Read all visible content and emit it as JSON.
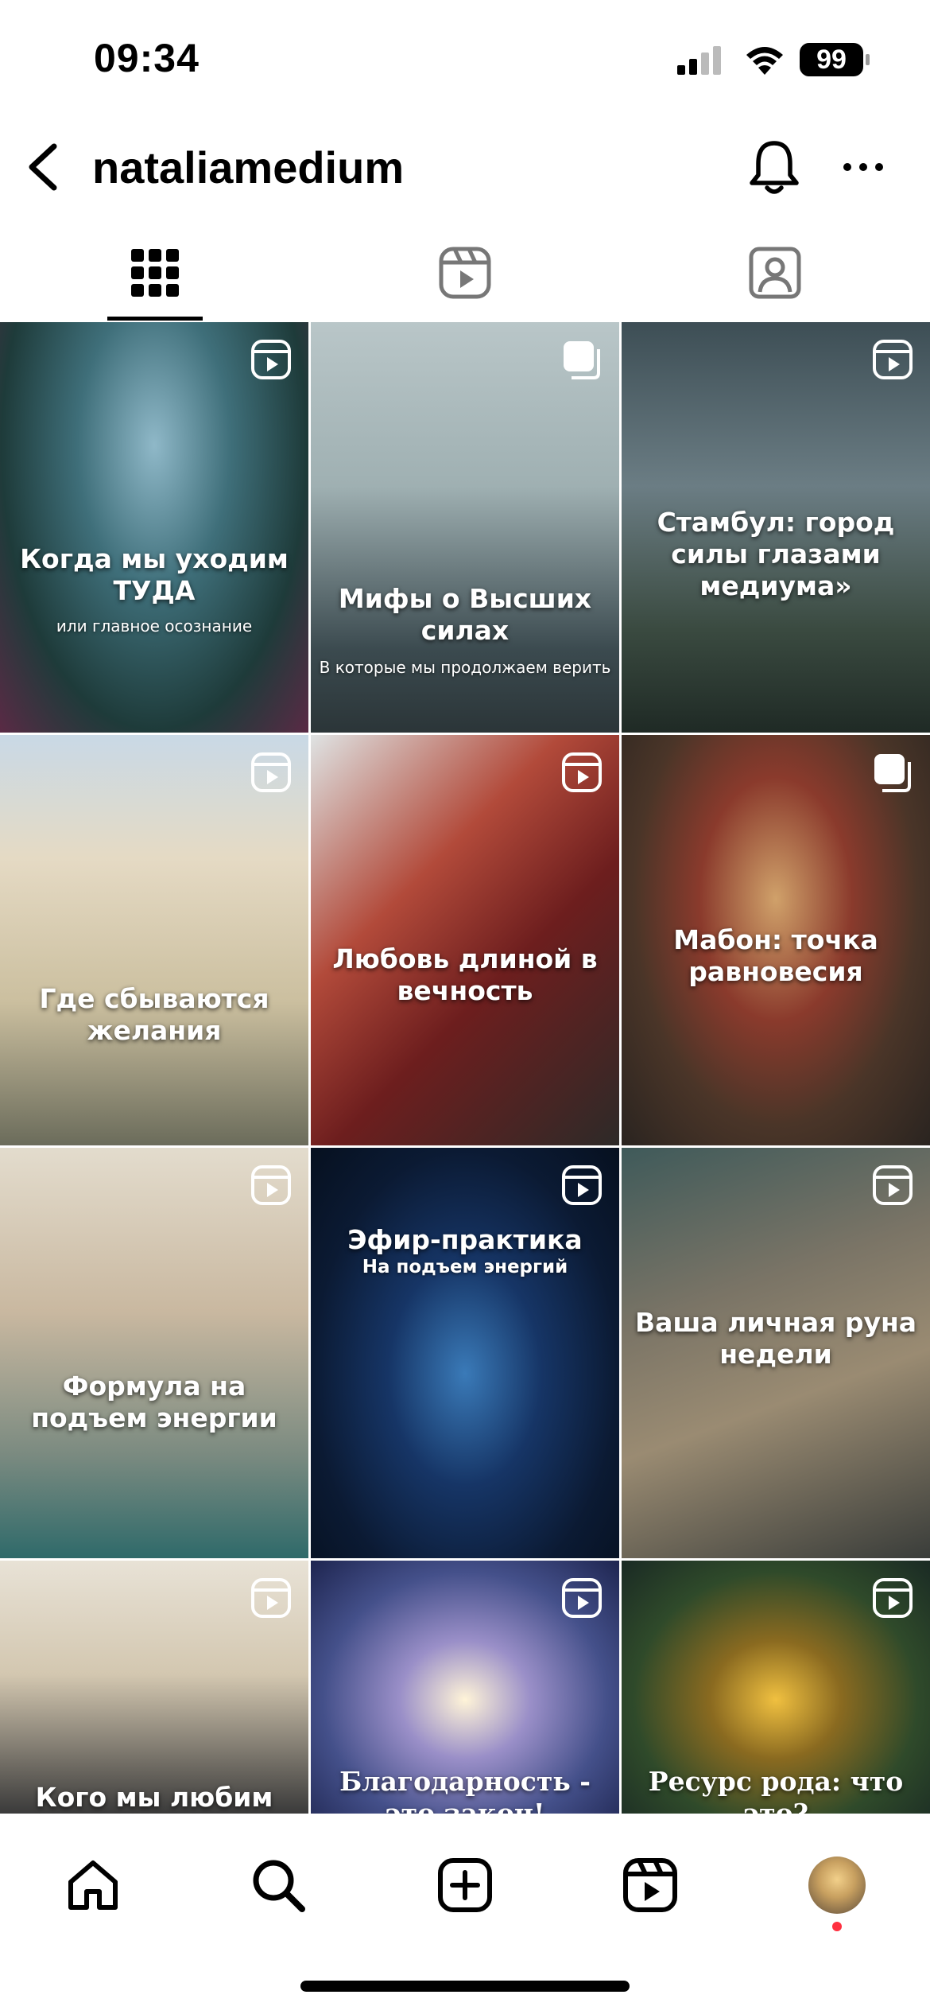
{
  "status_bar": {
    "time": "09:34",
    "battery": "99"
  },
  "header": {
    "username": "nataliamedium"
  },
  "tabs": [
    {
      "name": "posts-grid",
      "icon": "grid-icon",
      "active": true
    },
    {
      "name": "reels",
      "icon": "reels-icon",
      "active": false
    },
    {
      "name": "tagged",
      "icon": "tagged-icon",
      "active": false
    }
  ],
  "posts": [
    {
      "title": "Когда мы уходим ТУДА",
      "subtitle": "или главное осознание",
      "type": "reel"
    },
    {
      "title": "Мифы о Высших силах",
      "subtitle": "В которые мы продолжаем верить",
      "type": "carousel"
    },
    {
      "title": "Стамбул: город силы глазами медиума»",
      "subtitle": "",
      "type": "reel"
    },
    {
      "title": "Где сбываются желания",
      "subtitle": "",
      "type": "reel"
    },
    {
      "title": "Любовь длиной в вечность",
      "subtitle": "",
      "type": "reel"
    },
    {
      "title": "Мабон: точка равновесия",
      "subtitle": "",
      "type": "carousel"
    },
    {
      "title": "Формула на подъем энергии",
      "subtitle": "",
      "type": "reel"
    },
    {
      "title": "Эфир-практика",
      "subtitle": "На подъем энергий",
      "type": "reel"
    },
    {
      "title": "Ваша личная руна недели",
      "subtitle": "",
      "type": "reel"
    },
    {
      "title": "Кого мы любим",
      "subtitle": "",
      "type": "reel"
    },
    {
      "title": "Благодарность - это закон!",
      "subtitle": "",
      "type": "reel"
    },
    {
      "title": "Ресурс рода: что это?",
      "subtitle": "",
      "type": "reel"
    }
  ],
  "bottom_nav": [
    "home-icon",
    "search-icon",
    "create-icon",
    "reels-icon",
    "profile-avatar"
  ],
  "colors": {
    "accent_dot": "#ff3040",
    "text": "#000000"
  }
}
